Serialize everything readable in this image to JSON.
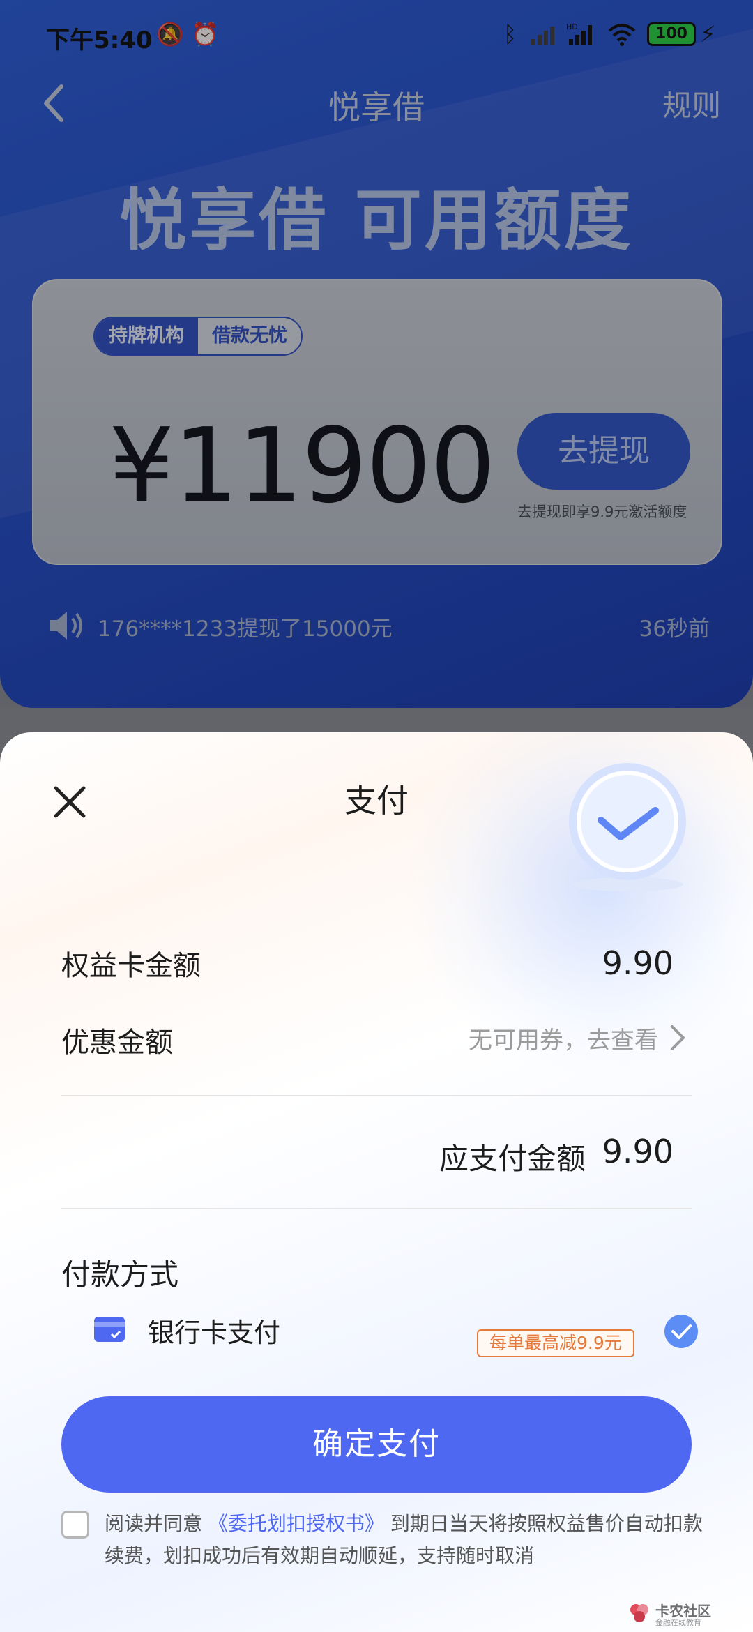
{
  "status_bar": {
    "time": "下午5:40",
    "battery": "100",
    "icons": [
      "mute-icon",
      "alarm-icon",
      "bluetooth-icon",
      "signal-icon",
      "hd-signal-icon",
      "wifi-icon",
      "charging-icon"
    ]
  },
  "nav": {
    "title": "悦享借",
    "rule_label": "规则"
  },
  "hero": {
    "heading": "悦享借 可用额度",
    "tags": [
      "持牌机构",
      "借款无忧"
    ],
    "amount": "¥11900",
    "withdraw_label": "去提现",
    "withdraw_note": "去提现即享9.9元激活额度"
  },
  "ticker": {
    "text": "176****1233提现了15000元",
    "time": "36秒前"
  },
  "sheet": {
    "title": "支付",
    "rows": [
      {
        "label": "权益卡金额",
        "value": "9.90"
      },
      {
        "label": "优惠金额",
        "value": "无可用券，去查看"
      }
    ],
    "due_label": "应支付金额",
    "due_value": "9.90",
    "method_title": "付款方式",
    "method": {
      "label": "银行卡支付",
      "promo": "每单最高减9.9元",
      "selected": true
    },
    "confirm_label": "确定支付",
    "agreement": {
      "prefix": "阅读并同意",
      "link": "《委托划扣授权书》",
      "suffix": "到期日当天将按照权益售价自动扣款续费，划扣成功后有效期自动顺延，支持随时取消"
    }
  },
  "watermark": {
    "name": "卡农社区",
    "sub": "金融在线教育"
  },
  "colors": {
    "primary": "#4f68f2",
    "promo": "#e67a3c",
    "hero": "#2a52c9"
  }
}
